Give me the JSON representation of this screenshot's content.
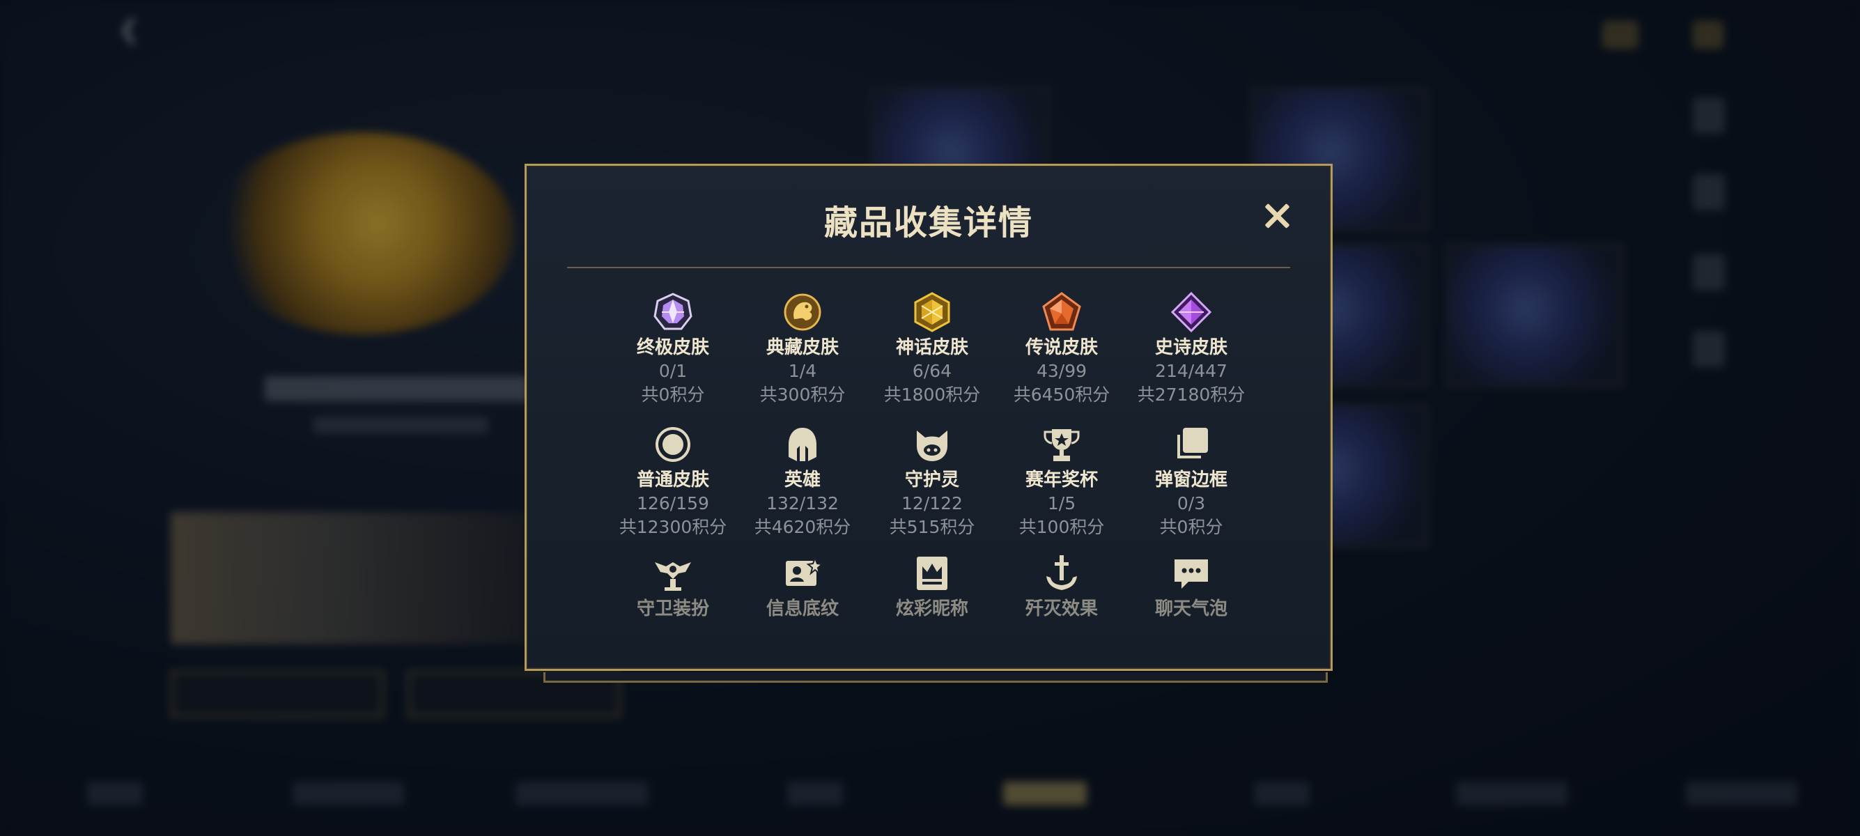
{
  "dialog": {
    "title": "藏品收集详情",
    "close_icon": "close-icon"
  },
  "categories": [
    {
      "name": "终极皮肤",
      "count": "0/1",
      "points": "共0积分",
      "icon": "ultimate-skin-gem-icon",
      "color": "#b48cf2"
    },
    {
      "name": "典藏皮肤",
      "count": "1/4",
      "points": "共300积分",
      "icon": "collector-dragon-icon",
      "color": "#e0a94a"
    },
    {
      "name": "神话皮肤",
      "count": "6/64",
      "points": "共1800积分",
      "icon": "mythic-hexagon-icon",
      "color": "#f0c23a"
    },
    {
      "name": "传说皮肤",
      "count": "43/99",
      "points": "共6450积分",
      "icon": "legend-pentagon-icon",
      "color": "#e56a2e"
    },
    {
      "name": "史诗皮肤",
      "count": "214/447",
      "points": "共27180积分",
      "icon": "epic-diamond-icon",
      "color": "#a54be0"
    },
    {
      "name": "普通皮肤",
      "count": "126/159",
      "points": "共12300积分",
      "icon": "common-circle-icon",
      "color": "#e0d7bf"
    },
    {
      "name": "英雄",
      "count": "132/132",
      "points": "共4620积分",
      "icon": "helmet-icon",
      "color": "#e0d7bf"
    },
    {
      "name": "守护灵",
      "count": "12/122",
      "points": "共515积分",
      "icon": "guardian-spirit-icon",
      "color": "#e0d7bf"
    },
    {
      "name": "赛年奖杯",
      "count": "1/5",
      "points": "共100积分",
      "icon": "trophy-icon",
      "color": "#e0d7bf"
    },
    {
      "name": "弹窗边框",
      "count": "0/3",
      "points": "共0积分",
      "icon": "popup-frame-icon",
      "color": "#e0d7bf"
    },
    {
      "name": "守卫装扮",
      "icon": "ward-skin-icon",
      "color": "#e0d7bf"
    },
    {
      "name": "信息底纹",
      "icon": "info-card-icon",
      "color": "#e0d7bf"
    },
    {
      "name": "炫彩昵称",
      "icon": "crown-nameplate-icon",
      "color": "#e0d7bf"
    },
    {
      "name": "歼灭效果",
      "icon": "anchor-sword-icon",
      "color": "#e0d7bf"
    },
    {
      "name": "聊天气泡",
      "icon": "chat-bubble-icon",
      "color": "#e0d7bf"
    }
  ],
  "colors": {
    "accent_gold": "#b69a5b",
    "panel_bg": "#18212c",
    "text_primary": "#efe6cf",
    "text_secondary": "#8d9399"
  }
}
